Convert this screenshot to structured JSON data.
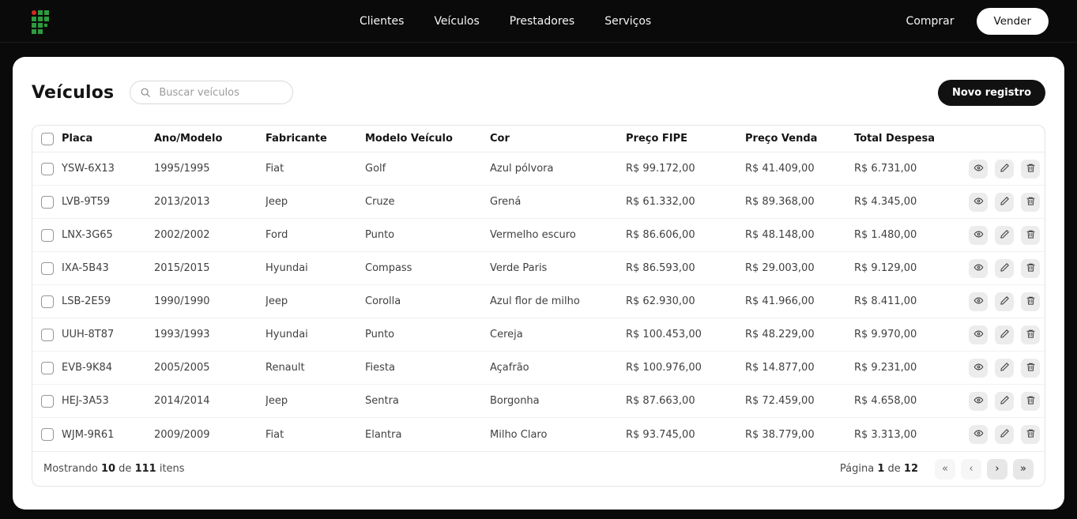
{
  "colors": {
    "header_bg": "#0a0a0a",
    "card_bg": "#ffffff",
    "logo_green": "#2e9b3f",
    "logo_red": "#d42a1e",
    "accent_dark": "#111111"
  },
  "header": {
    "nav": [
      "Clientes",
      "Veículos",
      "Prestadores",
      "Serviços"
    ],
    "comprar": "Comprar",
    "vender": "Vender"
  },
  "page": {
    "title": "Veículos",
    "search_placeholder": "Buscar veículos",
    "new_record": "Novo registro"
  },
  "icons": {
    "search": "magnifier",
    "view": "eye",
    "edit": "pencil",
    "delete": "trash"
  },
  "table": {
    "columns": [
      "Placa",
      "Ano/Modelo",
      "Fabricante",
      "Modelo Veículo",
      "Cor",
      "Preço FIPE",
      "Preço Venda",
      "Total Despesa"
    ],
    "rows": [
      {
        "placa": "YSW-6X13",
        "ano_modelo": "1995/1995",
        "fabricante": "Fiat",
        "modelo": "Golf",
        "cor": "Azul pólvora",
        "preco_fipe": "R$ 99.172,00",
        "preco_venda": "R$ 41.409,00",
        "total_despesa": "R$ 6.731,00"
      },
      {
        "placa": "LVB-9T59",
        "ano_modelo": "2013/2013",
        "fabricante": "Jeep",
        "modelo": "Cruze",
        "cor": "Grená",
        "preco_fipe": "R$ 61.332,00",
        "preco_venda": "R$ 89.368,00",
        "total_despesa": "R$ 4.345,00"
      },
      {
        "placa": "LNX-3G65",
        "ano_modelo": "2002/2002",
        "fabricante": "Ford",
        "modelo": "Punto",
        "cor": "Vermelho escuro",
        "preco_fipe": "R$ 86.606,00",
        "preco_venda": "R$ 48.148,00",
        "total_despesa": "R$ 1.480,00"
      },
      {
        "placa": "IXA-5B43",
        "ano_modelo": "2015/2015",
        "fabricante": "Hyundai",
        "modelo": "Compass",
        "cor": "Verde Paris",
        "preco_fipe": "R$ 86.593,00",
        "preco_venda": "R$ 29.003,00",
        "total_despesa": "R$ 9.129,00"
      },
      {
        "placa": "LSB-2E59",
        "ano_modelo": "1990/1990",
        "fabricante": "Jeep",
        "modelo": "Corolla",
        "cor": "Azul flor de milho",
        "preco_fipe": "R$ 62.930,00",
        "preco_venda": "R$ 41.966,00",
        "total_despesa": "R$ 8.411,00"
      },
      {
        "placa": "UUH-8T87",
        "ano_modelo": "1993/1993",
        "fabricante": "Hyundai",
        "modelo": "Punto",
        "cor": "Cereja",
        "preco_fipe": "R$ 100.453,00",
        "preco_venda": "R$ 48.229,00",
        "total_despesa": "R$ 9.970,00"
      },
      {
        "placa": "EVB-9K84",
        "ano_modelo": "2005/2005",
        "fabricante": "Renault",
        "modelo": "Fiesta",
        "cor": "Açafrão",
        "preco_fipe": "R$ 100.976,00",
        "preco_venda": "R$ 14.877,00",
        "total_despesa": "R$ 9.231,00"
      },
      {
        "placa": "HEJ-3A53",
        "ano_modelo": "2014/2014",
        "fabricante": "Jeep",
        "modelo": "Sentra",
        "cor": "Borgonha",
        "preco_fipe": "R$ 87.663,00",
        "preco_venda": "R$ 72.459,00",
        "total_despesa": "R$ 4.658,00"
      },
      {
        "placa": "WJM-9R61",
        "ano_modelo": "2009/2009",
        "fabricante": "Fiat",
        "modelo": "Elantra",
        "cor": "Milho Claro",
        "preco_fipe": "R$ 93.745,00",
        "preco_venda": "R$ 38.779,00",
        "total_despesa": "R$ 3.313,00"
      }
    ]
  },
  "footer": {
    "showing": {
      "prefix": "Mostrando",
      "count": "10",
      "of": "de",
      "total": "111",
      "suffix": "itens"
    },
    "pagination": {
      "label_prefix": "Página",
      "current": "1",
      "of": "de",
      "total": "12",
      "first": "«",
      "prev": "‹",
      "next": "›",
      "last": "»"
    }
  }
}
